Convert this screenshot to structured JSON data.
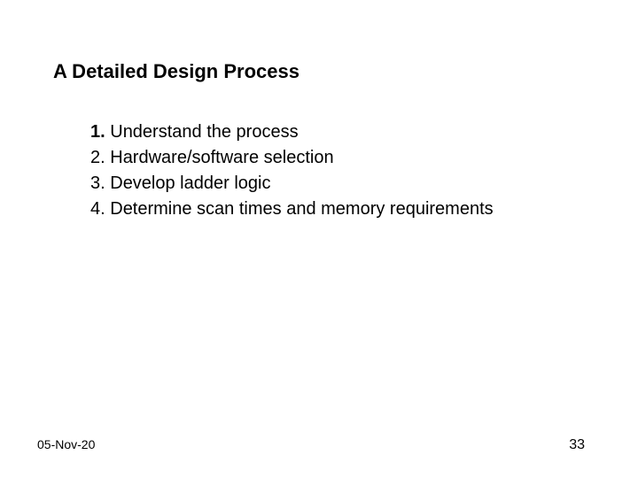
{
  "title": "A Detailed Design Process",
  "items": [
    {
      "num": "1.",
      "text": " Understand the process"
    },
    {
      "num": "2.",
      "text": " Hardware/software selection"
    },
    {
      "num": "3.",
      "text": " Develop ladder logic"
    },
    {
      "num": "4.",
      "text": " Determine scan times and memory requirements"
    }
  ],
  "footer": {
    "date": "05-Nov-20",
    "page": "33"
  }
}
